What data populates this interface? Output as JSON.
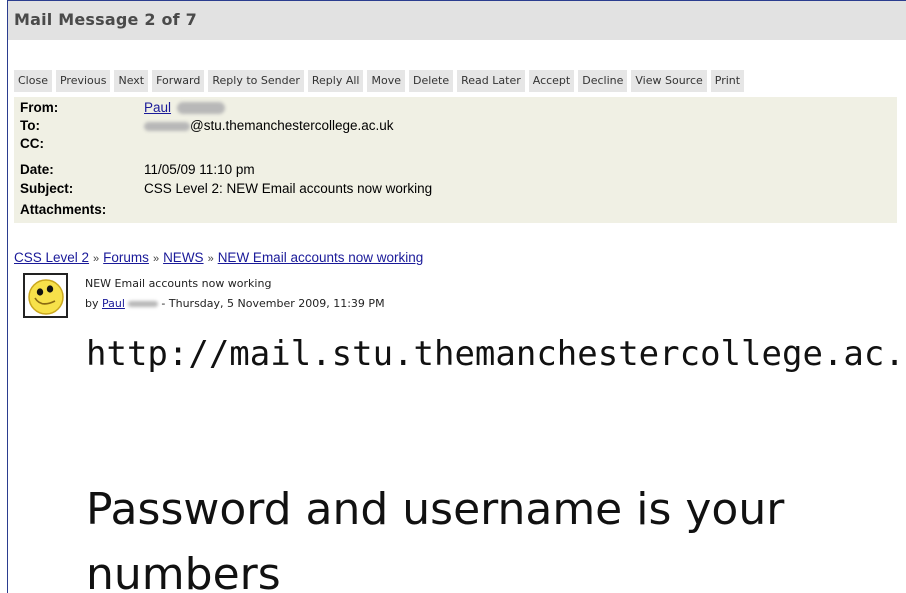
{
  "window": {
    "title": "Mail Message  2 of 7"
  },
  "toolbar": {
    "buttons": [
      "Close",
      "Previous",
      "Next",
      "Forward",
      "Reply to Sender",
      "Reply All",
      "Move",
      "Delete",
      "Read Later",
      "Accept",
      "Decline",
      "View Source",
      "Print"
    ]
  },
  "message": {
    "from_label": "From:",
    "from_value": "Paul",
    "to_label": "To:",
    "to_value": "@stu.themanchestercollege.ac.uk",
    "cc_label": "CC:",
    "cc_value": "",
    "date_label": "Date:",
    "date_value": "11/05/09  11:10 pm",
    "subject_label": "Subject:",
    "subject_value": "CSS Level 2: NEW Email accounts now working",
    "attachments_label": "Attachments:",
    "attachments_value": ""
  },
  "breadcrumb": {
    "items": [
      "CSS Level 2",
      "Forums",
      "NEWS",
      "NEW Email accounts now working"
    ],
    "separator": "»"
  },
  "post": {
    "title": "NEW Email accounts now working",
    "by_prefix": "by",
    "author": "Paul",
    "date_suffix": "- Thursday, 5 November 2009, 11:39 PM"
  },
  "body": {
    "line1": "http://mail.stu.themanchestercollege.ac.uk",
    "line2": "Password and username is your",
    "line3": "numbers"
  },
  "colors": {
    "frame_border": "#2b3d8f",
    "header_bg": "#f0f0e4",
    "link": "#1a1a99"
  }
}
